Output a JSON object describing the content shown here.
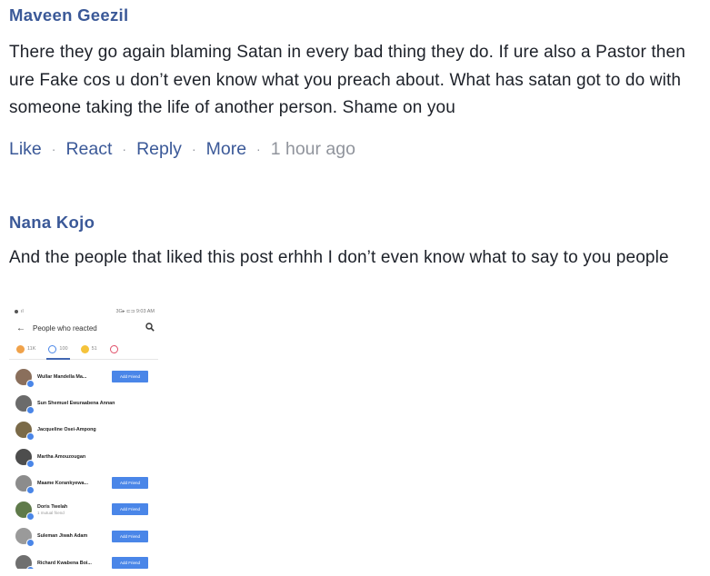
{
  "comments": [
    {
      "author": "Maveen Geezil",
      "text": "There they go again blaming Satan in every bad thing they do. If ure also a Pastor then ure Fake cos u don’t even know what you preach about. What has satan got to do with someone taking the life of another person. Shame on you",
      "actions": {
        "like": "Like",
        "react": "React",
        "reply": "Reply",
        "more": "More",
        "sep": "·",
        "time": "1 hour ago"
      }
    },
    {
      "author": "Nana Kojo",
      "text": "And the people that liked this post erhhh I don’t even know what to say to you people"
    }
  ],
  "attachment": {
    "status_time": "9:03 AM",
    "status_icons": "3G▸ ⊏⊐",
    "header_title": "People who reacted",
    "back_icon": "arrow-left-icon",
    "search_icon": "search-icon",
    "tabs": [
      {
        "count": "11K",
        "emoji": "reaction-like-icon",
        "color": "#f0a24a"
      },
      {
        "count": "100",
        "emoji": "reaction-like-icon",
        "color": "#4a86e8"
      },
      {
        "count": "51",
        "emoji": "reaction-haha-icon",
        "color": "#f5c33b"
      }
    ],
    "people": [
      {
        "name": "Wullar Mandella Ma...",
        "sub": "",
        "button": "Add Friend",
        "avatar_color": "#8a6f5c"
      },
      {
        "name": "Sun Shemuel Ewuraabena Annan",
        "sub": "",
        "button": "",
        "avatar_color": "#6b6b6b"
      },
      {
        "name": "Jacqueline Osei-Ampong",
        "sub": "",
        "button": "",
        "avatar_color": "#7a6a48"
      },
      {
        "name": "Martha Amouzougan",
        "sub": "",
        "button": "",
        "avatar_color": "#4d4d4d"
      },
      {
        "name": "Maame Korankyewa...",
        "sub": "",
        "button": "Add Friend",
        "avatar_color": "#8c8c8c"
      },
      {
        "name": "Doris Twelah",
        "sub": "1 mutual friend",
        "button": "Add Friend",
        "avatar_color": "#5f7a4a"
      },
      {
        "name": "Suleman Jiwah Adam",
        "sub": "",
        "button": "Add Friend",
        "avatar_color": "#9a9a9a"
      },
      {
        "name": "Richard Kwabena Boi...",
        "sub": "",
        "button": "Add Friend",
        "avatar_color": "#6f6f6f"
      }
    ],
    "badge_color": "#4a86e8",
    "accent": "#4267b2"
  },
  "colors": {
    "author": "#3b5998",
    "link": "#3b5998",
    "muted": "#90949c",
    "text": "#1d2129"
  }
}
